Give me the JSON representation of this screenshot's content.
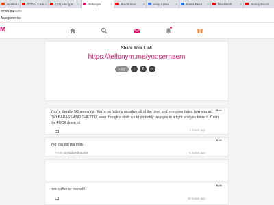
{
  "browser": {
    "tabs": [
      {
        "label": "redditor",
        "favicon_color": "#ff4500"
      },
      {
        "label": "GTA V Care",
        "favicon_color": "#ff0000"
      },
      {
        "label": "(22) Using M",
        "favicon_color": "#ff0000"
      },
      {
        "label": "Tellonym",
        "favicon_color": "#e2156f",
        "active": true
      },
      {
        "label": "Teach Your",
        "favicon_color": "#ff0000"
      },
      {
        "label": "asap k!ynu",
        "favicon_color": "#4285f4"
      },
      {
        "label": "News Feed",
        "favicon_color": "#1877f2"
      },
      {
        "label": "Blacklist®",
        "favicon_color": "#ff0000"
      },
      {
        "label": "Roddy Ricch",
        "favicon_color": "#ff0000"
      }
    ],
    "address": {
      "domain": "onym.me",
      "path": "/tells"
    },
    "bookmark": "Assignments"
  },
  "navbar": {
    "logo": "M",
    "accent": "#e2156f",
    "icons": [
      "home-icon",
      "search-icon",
      "inbox-icon",
      "notifications-icon",
      "gift-icon"
    ]
  },
  "share": {
    "title": "Share Your Link",
    "link": "https://tellonym.me/yoosernaem",
    "copy_label": "Copy",
    "social": [
      {
        "name": "twitter-icon",
        "glyph": "t"
      },
      {
        "name": "facebook-icon",
        "glyph": "f"
      },
      {
        "name": "whatsapp-icon",
        "glyph": "○"
      }
    ]
  },
  "tells": [
    {
      "text": "You’re literally SO annoying. You’re so fucking negative all of the time, and everyone hates how you act “SO BADASS AND GHETTO” even though a sloth could probably take you in a fight and you know it. Calm the FUCK down lol",
      "time": "3 hours ago"
    },
    {
      "text": "Yes you did ma man",
      "from_label": "From",
      "from_name": "crystalizedtrauma",
      "time": "5 hours ago"
    },
    {
      "text": "free coffee or free wifi",
      "time": "16 hours ago"
    }
  ]
}
